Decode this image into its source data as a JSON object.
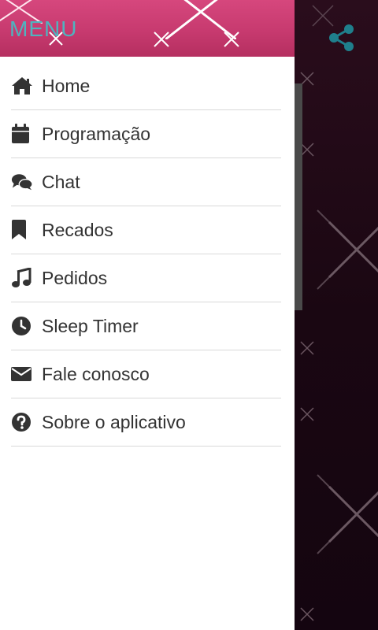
{
  "drawer": {
    "title": "MENU",
    "items": [
      {
        "label": "Home",
        "icon": "home-icon"
      },
      {
        "label": "Programação",
        "icon": "calendar-icon"
      },
      {
        "label": "Chat",
        "icon": "chat-icon"
      },
      {
        "label": "Recados",
        "icon": "bookmark-icon"
      },
      {
        "label": "Pedidos",
        "icon": "music-icon"
      },
      {
        "label": "Sleep Timer",
        "icon": "clock-icon"
      },
      {
        "label": "Fale conosco",
        "icon": "envelope-icon"
      },
      {
        "label": "Sobre o aplicativo",
        "icon": "question-circle-icon"
      }
    ]
  },
  "toolbar": {
    "share_icon": "share-icon"
  },
  "colors": {
    "header_pink": "#c73a6f",
    "title_teal": "#4fb3bf",
    "menu_text": "#333333",
    "background_dark": "#1a0712"
  }
}
